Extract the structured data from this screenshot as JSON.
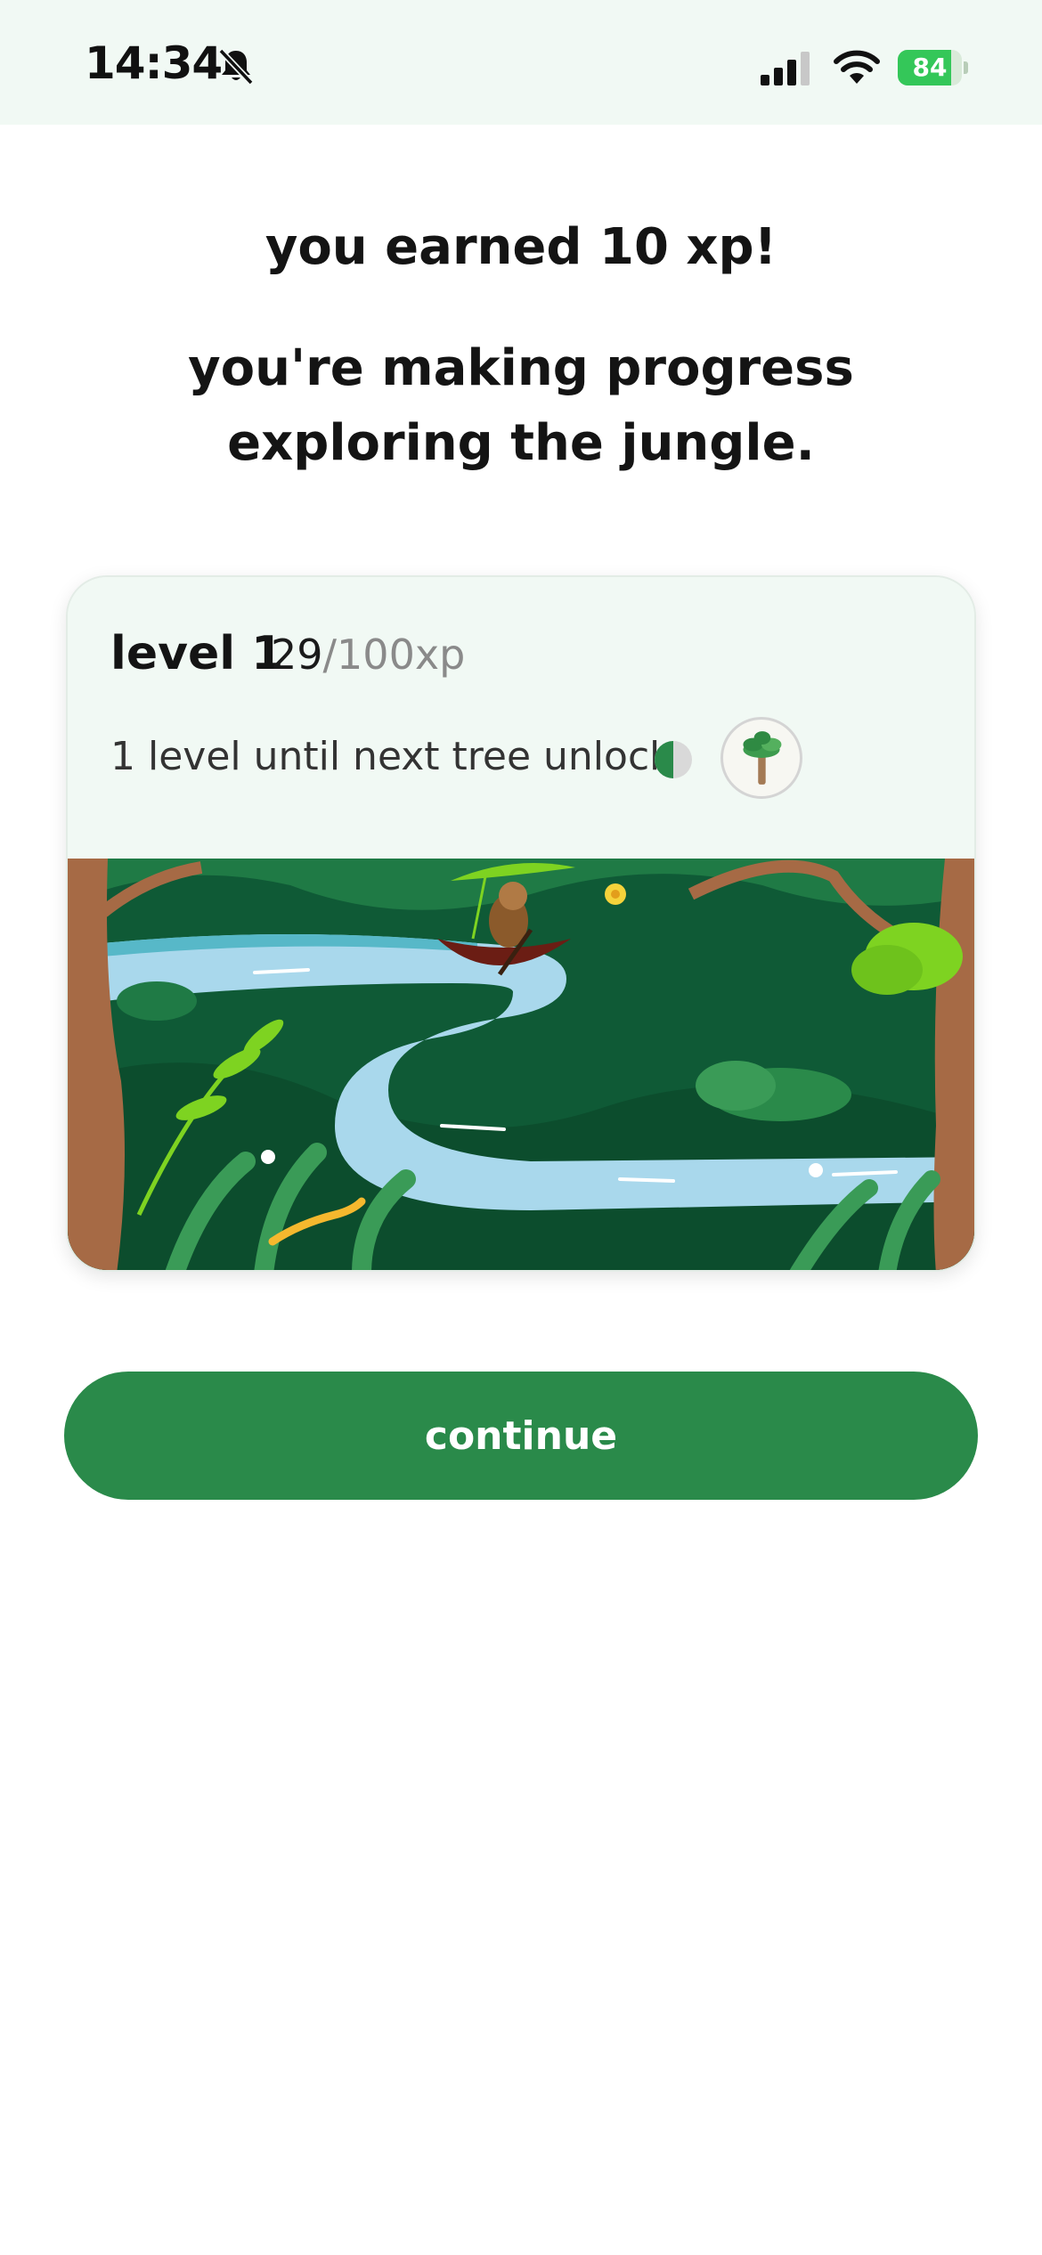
{
  "status_bar": {
    "time": "14:34",
    "battery_level": "84",
    "battery_fraction": 0.84,
    "icons": [
      "bell-slash-icon",
      "cellular-signal-icon",
      "wifi-icon",
      "battery-charging-icon"
    ]
  },
  "main": {
    "heading": "you earned 10 xp!",
    "subheading": "you're making progress exploring the jungle."
  },
  "card": {
    "level_label": "level 1",
    "xp_current": "29",
    "xp_total": "/100xp",
    "xp_fraction": 0.29,
    "unlock_text": "1 level until next tree unlock",
    "unlock_progress_fraction": 0.5,
    "badge_icon": "palm-tree-icon",
    "scene_icons": [
      "sloth-in-canoe-icon",
      "lizard-icon",
      "river-icon",
      "jungle-trees-icon"
    ]
  },
  "actions": {
    "continue_label": "continue"
  },
  "colors": {
    "status_bar_bg": "#f1f9f4",
    "card_bg": "#f1f9f4",
    "primary_green": "#2a8a4a",
    "battery_green": "#34c759",
    "text_dark": "#141414",
    "text_muted": "#8a8a8a",
    "river_blue": "#a9d8ec",
    "jungle_dark": "#0f5a36"
  }
}
